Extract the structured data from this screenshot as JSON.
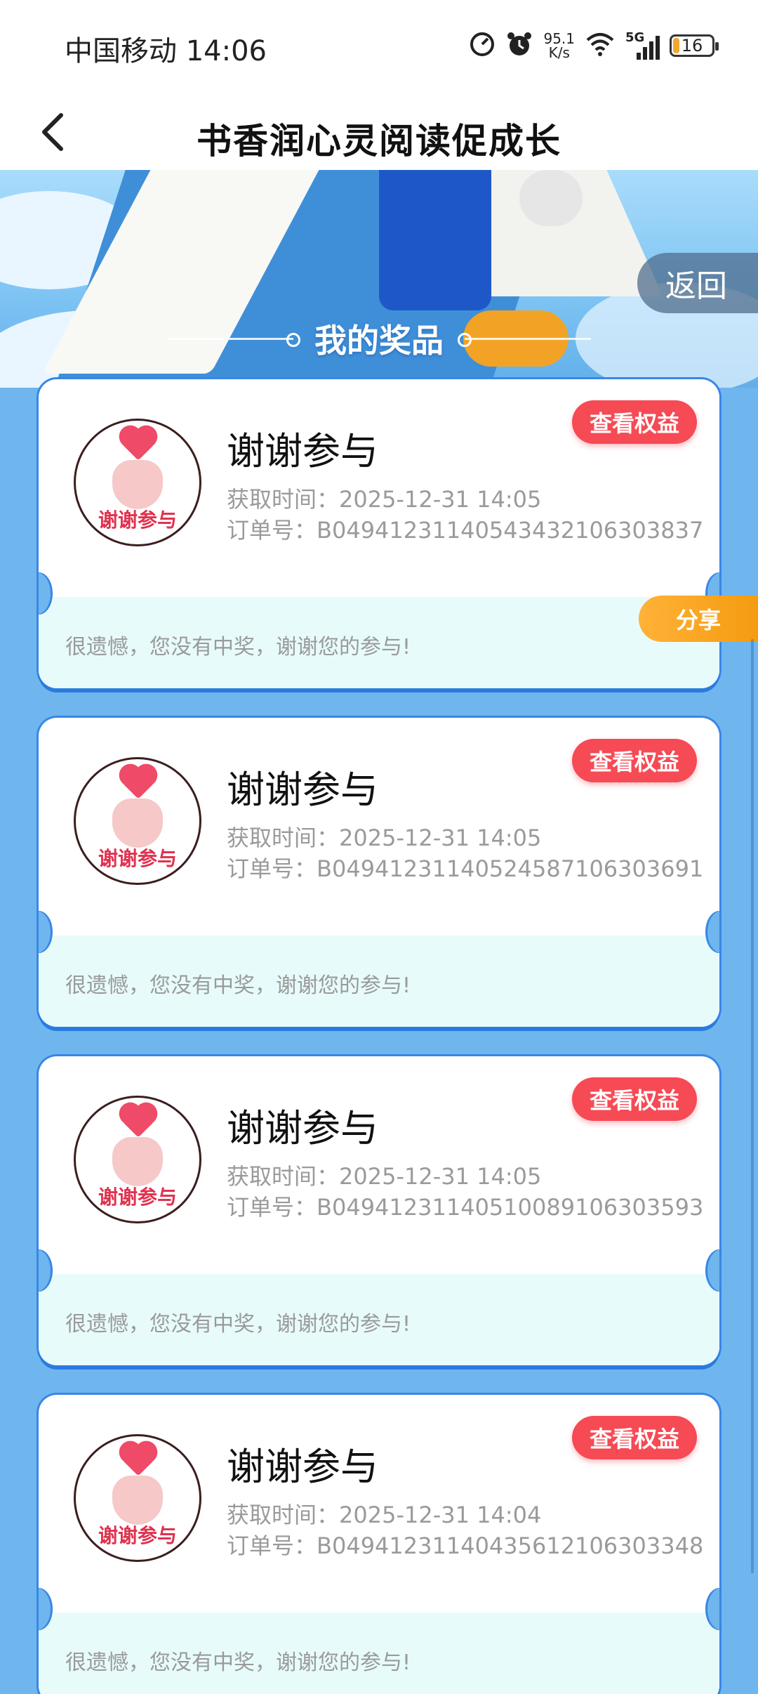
{
  "status_bar": {
    "carrier_time": "中国移动 14:06",
    "speed_value": "95.1",
    "speed_unit": "K/s",
    "network": "5G",
    "battery": "16",
    "battery_color": "#f0a830"
  },
  "header": {
    "title": "书香润心灵阅读促成长",
    "back_icon": "chevron-left-icon"
  },
  "banner": {
    "back_label": "返回",
    "section_title": "我的奖品"
  },
  "floating": {
    "share_label": "分享"
  },
  "prizes": [
    {
      "name": "谢谢参与",
      "image_text": "谢谢参与",
      "time_label": "获取时间：",
      "time_value": "2025-12-31 14:05",
      "order_label": "订单号：",
      "order_value": "B0494123114054343210630383​7",
      "button_label": "查看权益",
      "message": "很遗憾，您没有中奖，谢谢您的参与!"
    },
    {
      "name": "谢谢参与",
      "image_text": "谢谢参与",
      "time_label": "获取时间：",
      "time_value": "2025-12-31 14:05",
      "order_label": "订单号：",
      "order_value": "B049412311405245871063036​91",
      "button_label": "查看权益",
      "message": "很遗憾，您没有中奖，谢谢您的参与!"
    },
    {
      "name": "谢谢参与",
      "image_text": "谢谢参与",
      "time_label": "获取时间：",
      "time_value": "2025-12-31 14:05",
      "order_label": "订单号：",
      "order_value": "B049412311405100891063035​93",
      "button_label": "查看权益",
      "message": "很遗憾，您没有中奖，谢谢您的参与!"
    },
    {
      "name": "谢谢参与",
      "image_text": "谢谢参与",
      "time_label": "获取时间：",
      "time_value": "2025-12-31 14:04",
      "order_label": "订单号：",
      "order_value": "B049412311404356121063033​48",
      "button_label": "查看权益",
      "message": "很遗憾，您没有中奖，谢谢您的参与!"
    }
  ],
  "colors": {
    "page_bg": "#6fb6ee",
    "card_border": "#3a86e6",
    "rights_button": "#f64a55",
    "share_button": "#f59b10",
    "card_bottom_bg": "#e8fbfb"
  }
}
